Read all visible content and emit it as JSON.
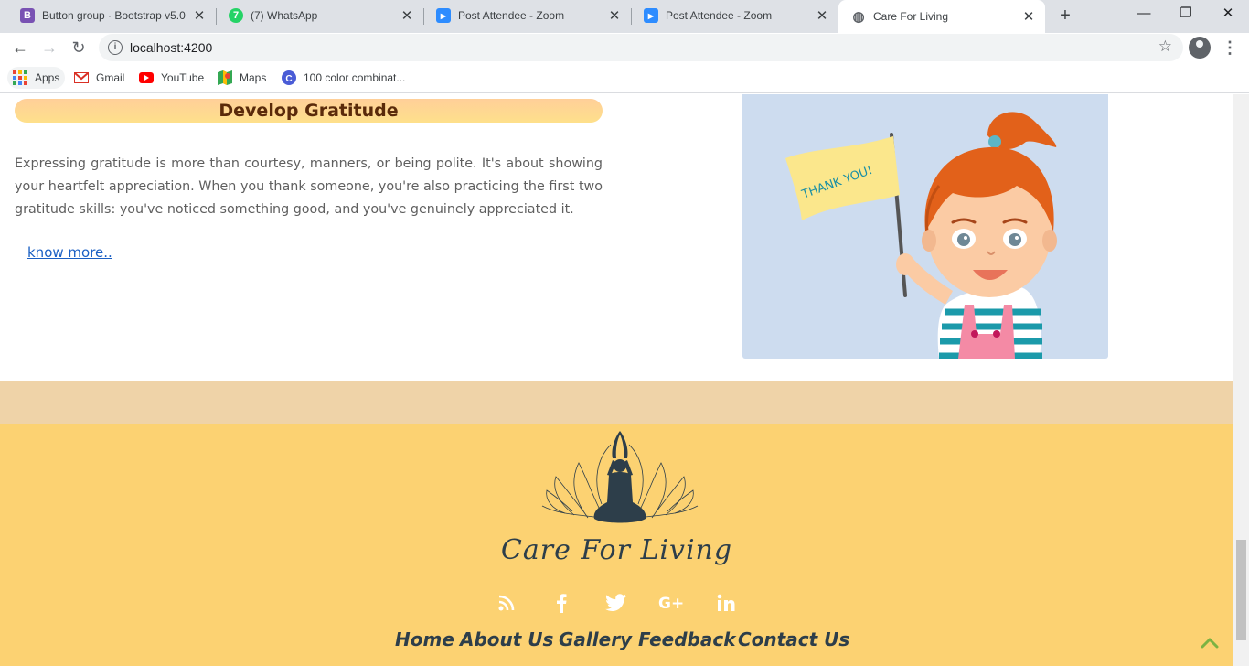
{
  "browser": {
    "tabs": [
      {
        "title": "Button group · Bootstrap v5.0",
        "icon": "bootstrap-icon",
        "icon_glyph": "B",
        "icon_color": "#7952b3"
      },
      {
        "title": "(7) WhatsApp",
        "icon": "whatsapp-icon",
        "icon_glyph": "7",
        "icon_color": "#25d366"
      },
      {
        "title": "Post Attendee - Zoom",
        "icon": "zoom-icon",
        "icon_glyph": "▶",
        "icon_color": "#2d8cff"
      },
      {
        "title": "Post Attendee - Zoom",
        "icon": "zoom-icon",
        "icon_glyph": "▶",
        "icon_color": "#2d8cff"
      },
      {
        "title": "Care For Living",
        "icon": "globe-icon",
        "icon_glyph": "◍",
        "icon_color": "#5f6368"
      }
    ],
    "url": "localhost:4200",
    "bookmarks": [
      {
        "label": "Apps",
        "icon": "apps-grid-icon"
      },
      {
        "label": "Gmail",
        "icon": "gmail-icon"
      },
      {
        "label": "YouTube",
        "icon": "youtube-icon"
      },
      {
        "label": "Maps",
        "icon": "maps-icon"
      },
      {
        "label": "100 color combinat...",
        "icon": "color-combination-icon"
      }
    ]
  },
  "section": {
    "heading": "Develop Gratitude",
    "paragraph": "Expressing gratitude is more than courtesy, manners, or being polite. It's about showing your heartfelt appreciation. When you thank someone, you're also practicing the first two gratitude skills: you've noticed something good, and you've genuinely appreciated it.",
    "link": "know more..",
    "illustration": {
      "flag_text": "THANK YOU!",
      "background": "#cddcef"
    }
  },
  "footer": {
    "brand": "Care For Living",
    "social": [
      "rss-icon",
      "facebook-icon",
      "twitter-icon",
      "google-plus-icon",
      "linkedin-icon"
    ],
    "nav": [
      "Home",
      "About Us",
      "Gallery",
      "Feedback",
      "Contact Us"
    ],
    "colors": {
      "band": "#efd3a8",
      "footer": "#fcd272",
      "text": "#2d3e4a"
    }
  }
}
